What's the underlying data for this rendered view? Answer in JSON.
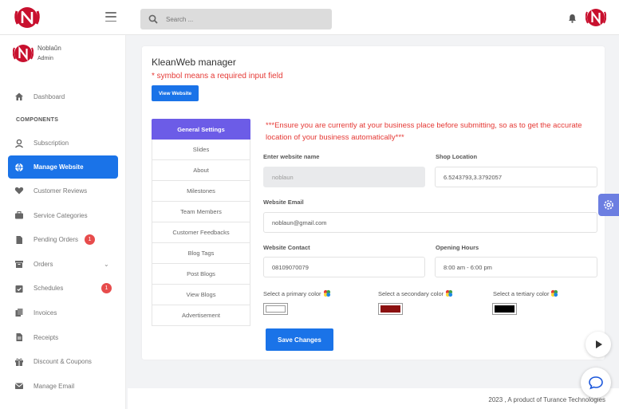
{
  "header": {
    "search_placeholder": "Search ..."
  },
  "profile": {
    "name": "Noblaŭn",
    "role": "Admin"
  },
  "sidebar": {
    "dashboard": "Dashboard",
    "section_label": "COMPONENTS",
    "items": [
      {
        "label": "Subscription",
        "icon": "user-icon"
      },
      {
        "label": "Manage Website",
        "icon": "globe-icon",
        "active": true
      },
      {
        "label": "Customer Reviews",
        "icon": "heart-icon"
      },
      {
        "label": "Service Categories",
        "icon": "briefcase-icon"
      },
      {
        "label": "Pending Orders",
        "icon": "file-icon",
        "badge": "1"
      },
      {
        "label": "Orders",
        "icon": "box-icon"
      },
      {
        "label": "Schedules",
        "icon": "calendar-check-icon",
        "badge": "1"
      },
      {
        "label": "Invoices",
        "icon": "copy-icon"
      },
      {
        "label": "Receipts",
        "icon": "file-text-icon"
      },
      {
        "label": "Discount & Coupons",
        "icon": "gift-icon"
      },
      {
        "label": "Manage Email",
        "icon": "envelope-icon"
      }
    ]
  },
  "main": {
    "title": "KleanWeb manager",
    "required_note": "* symbol means a required input field",
    "view_button": "View Website",
    "tabs": [
      "General Settings",
      "Slides",
      "About",
      "Milestones",
      "Team Members",
      "Customer Feedbacks",
      "Blog Tags",
      "Post Blogs",
      "View Blogs",
      "Advertisement"
    ],
    "warning": "***Ensure you are currently at your business place before submitting, so as to get the accurate location of your business automatically***",
    "form": {
      "website_name_label": "Enter website name",
      "website_name_value": "noblaun",
      "shop_location_label": "Shop Location",
      "shop_location_value": "6.5243793,3.3792057",
      "email_label": "Website Email",
      "email_value": "noblaun@gmail.com",
      "contact_label": "Website Contact",
      "contact_value": "08109070079",
      "hours_label": "Opening Hours",
      "hours_value": "8:00 am - 6:00 pm",
      "primary_color_label": "Select a primary color",
      "secondary_color_label": "Select a secondary color",
      "tertiary_color_label": "Select a tertiary color",
      "primary_color": "#ffffff",
      "secondary_color": "#8b1010",
      "tertiary_color": "#000000"
    },
    "save_button": "Save Changes"
  },
  "footer": {
    "text": "2023 , A product of Turance Technologies"
  },
  "colors": {
    "accent": "#1a73e8",
    "tab_active": "#6c5ce7",
    "error": "#e53935",
    "brand_red": "#c8102e"
  }
}
